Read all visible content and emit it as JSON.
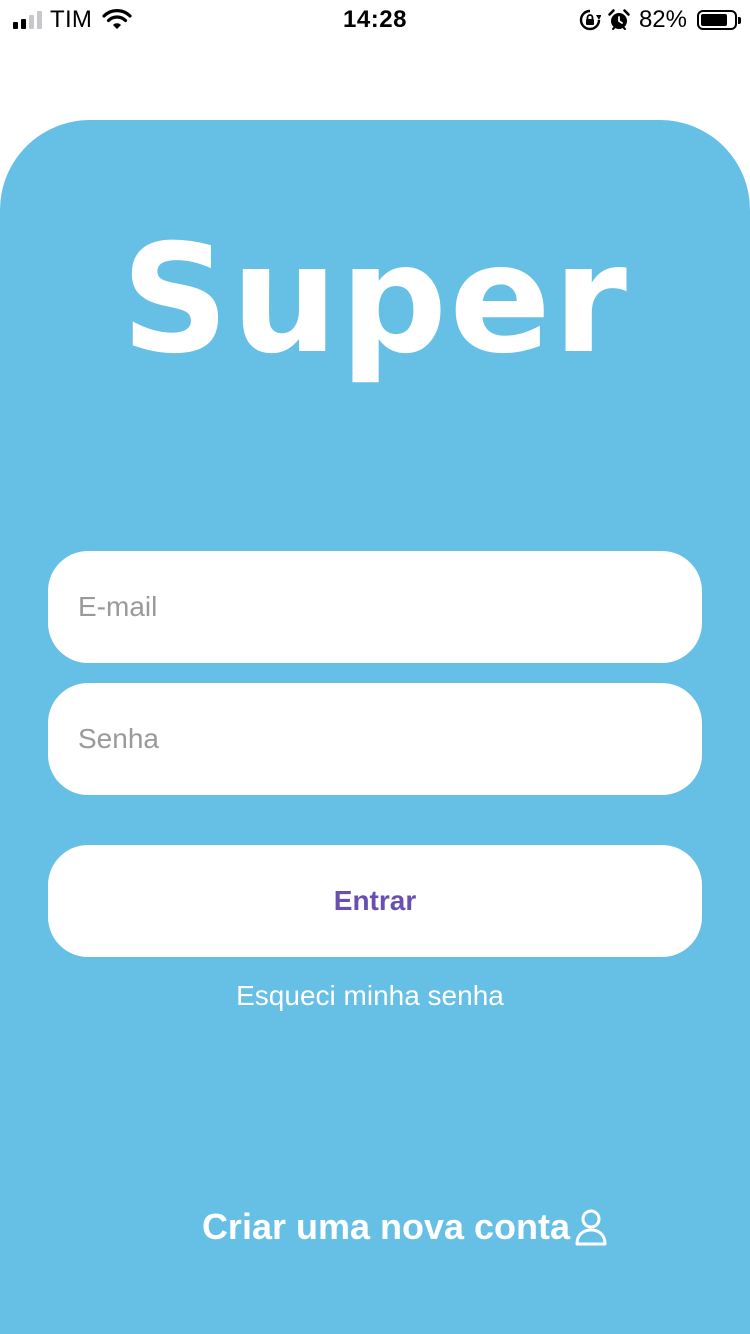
{
  "status_bar": {
    "carrier": "TIM",
    "time": "14:28",
    "battery_percent": "82%",
    "battery_level": 0.82,
    "signal_bars_on": 2,
    "icons": [
      "signal-icon",
      "wifi-icon",
      "orientation-lock-icon",
      "alarm-icon",
      "battery-icon"
    ]
  },
  "logo": {
    "text": "Super"
  },
  "form": {
    "email_placeholder": "E-mail",
    "email_value": "",
    "password_placeholder": "Senha",
    "password_value": "",
    "submit_label": "Entrar",
    "forgot_password": "Esqueci minha senha",
    "create_account": "Criar uma nova conta"
  },
  "colors": {
    "panel_background": "#66bfe5",
    "button_text": "#6a4fb3",
    "field_background": "#ffffff",
    "placeholder": "#9a9a9a"
  }
}
